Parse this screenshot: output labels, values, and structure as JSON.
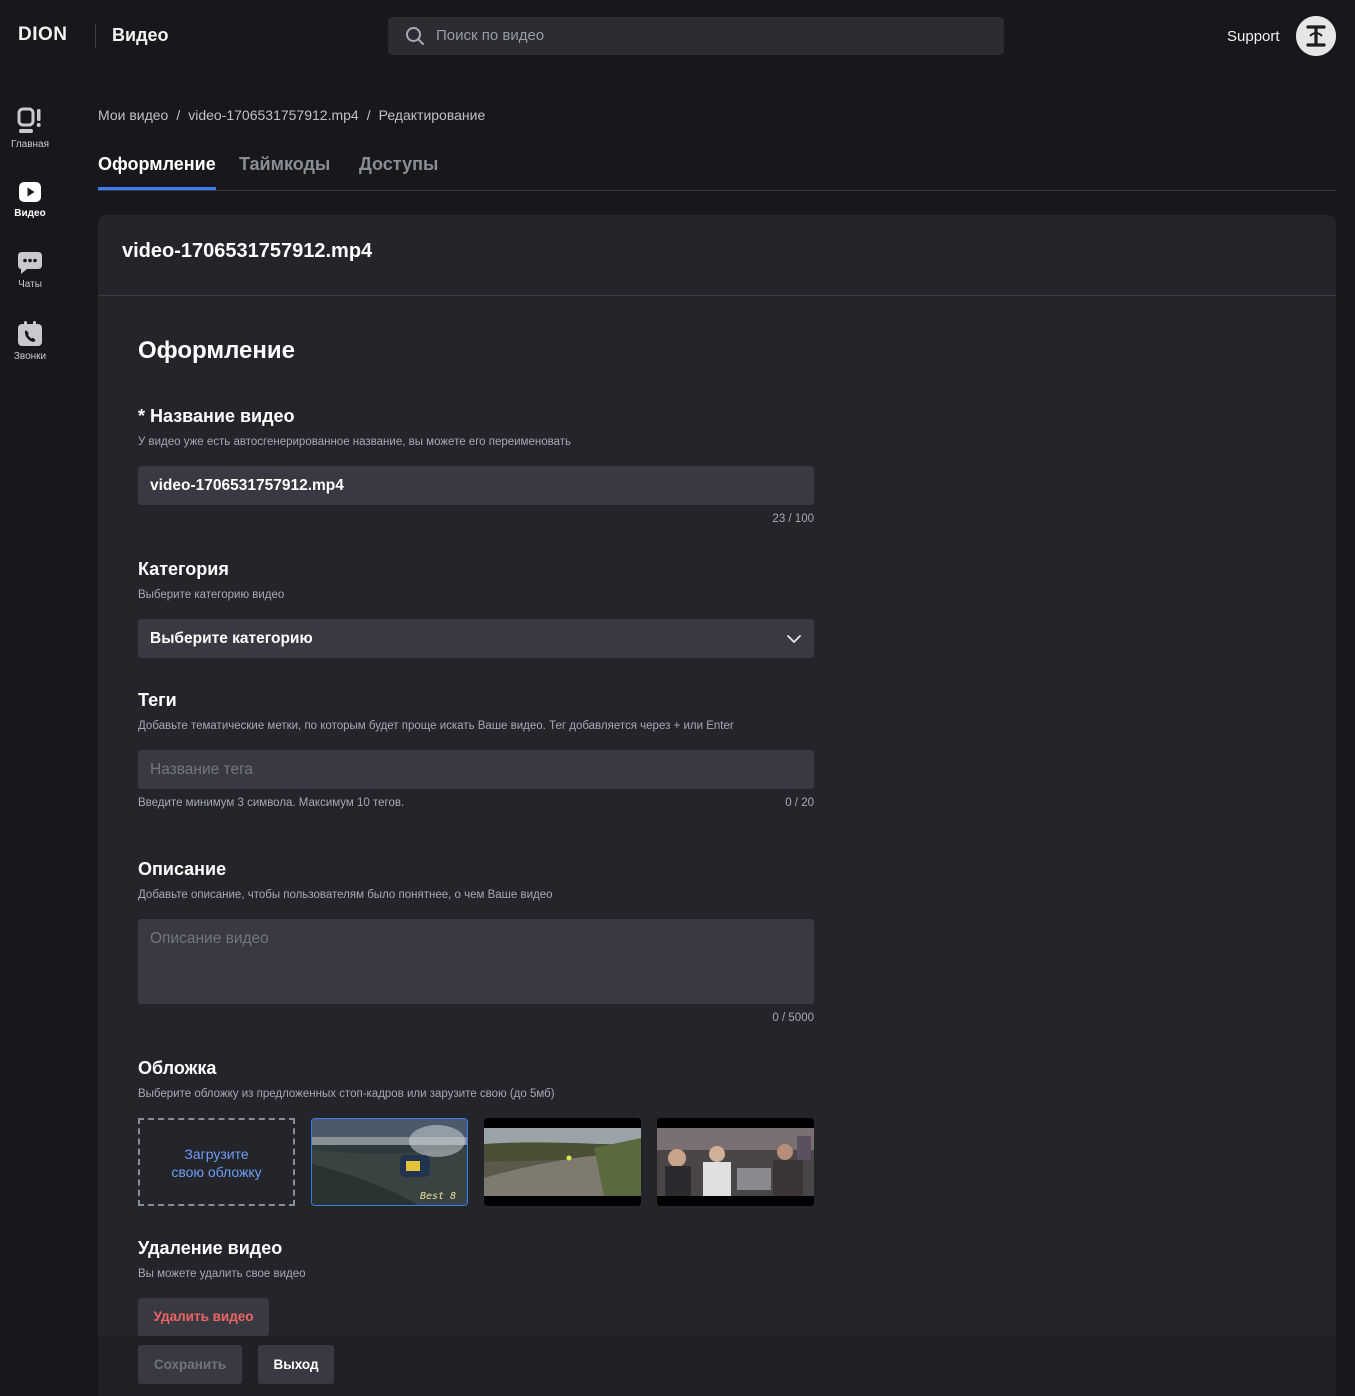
{
  "header": {
    "logo": "DION",
    "app_title": "Видео",
    "search_placeholder": "Поиск по видео",
    "support_label": "Support",
    "avatar_icon": "brand-avatar-icon"
  },
  "sidebar": {
    "items": [
      {
        "label": "Главная",
        "icon": "home-icon",
        "active": false
      },
      {
        "label": "Видео",
        "icon": "play-icon",
        "active": true
      },
      {
        "label": "Чаты",
        "icon": "chat-icon",
        "active": false
      },
      {
        "label": "Звонки",
        "icon": "calls-icon",
        "active": false
      }
    ]
  },
  "breadcrumb": {
    "items": [
      "Мои видео",
      "video-1706531757912.mp4",
      "Редактирование"
    ],
    "separator": "/"
  },
  "tabs": [
    {
      "label": "Оформление",
      "active": true
    },
    {
      "label": "Таймкоды",
      "active": false
    },
    {
      "label": "Доступы",
      "active": false
    }
  ],
  "card": {
    "title": "video-1706531757912.mp4",
    "section_title": "Оформление",
    "name_field": {
      "label": "* Название видео",
      "hint": "У видео уже есть автосгенерированное название, вы можете его переименовать",
      "value": "video-1706531757912.mp4",
      "counter": "23 / 100"
    },
    "category_field": {
      "label": "Категория",
      "hint": "Выберите категорию видео",
      "selected": "Выберите категорию"
    },
    "tags_field": {
      "label": "Теги",
      "hint": "Добавьте тематические метки, по которым будет проще искать Ваше видео. Тег добавляется через + или Enter",
      "placeholder": "Название тега",
      "note": "Введите минимум 3 символа. Максимум 10 тегов.",
      "counter": "0 / 20"
    },
    "description_field": {
      "label": "Описание",
      "hint": "Добавьте описание, чтобы пользователям было понятнее, о чем Ваше видео",
      "placeholder": "Описание видео",
      "counter": "0 / 5000"
    },
    "cover_field": {
      "label": "Обложка",
      "hint": "Выберите обложку из предложенных стоп-кадров или зарузите свою (до 5мб)",
      "upload_line1": "Загрузите",
      "upload_line2": "свою обложку",
      "thumbnail_overlay": "Best 8",
      "selected_index": 0
    },
    "delete_section": {
      "label": "Удаление видео",
      "hint": "Вы можете удалить свое видео",
      "button": "Удалить видео"
    }
  },
  "footer": {
    "save_label": "Сохранить",
    "exit_label": "Выход"
  },
  "colors": {
    "accent": "#3d7bf0",
    "danger": "#ef6566",
    "background": "#17181c",
    "card": "#24252b",
    "input": "#383941"
  }
}
